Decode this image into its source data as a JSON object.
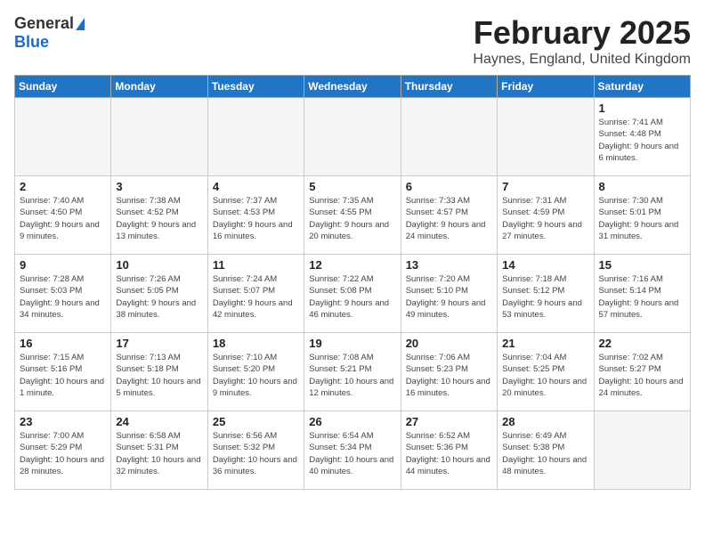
{
  "header": {
    "logo_general": "General",
    "logo_blue": "Blue",
    "title": "February 2025",
    "location": "Haynes, England, United Kingdom"
  },
  "calendar": {
    "headers": [
      "Sunday",
      "Monday",
      "Tuesday",
      "Wednesday",
      "Thursday",
      "Friday",
      "Saturday"
    ],
    "weeks": [
      [
        {
          "day": "",
          "info": "",
          "empty": true
        },
        {
          "day": "",
          "info": "",
          "empty": true
        },
        {
          "day": "",
          "info": "",
          "empty": true
        },
        {
          "day": "",
          "info": "",
          "empty": true
        },
        {
          "day": "",
          "info": "",
          "empty": true
        },
        {
          "day": "",
          "info": "",
          "empty": true
        },
        {
          "day": "1",
          "info": "Sunrise: 7:41 AM\nSunset: 4:48 PM\nDaylight: 9 hours and 6 minutes."
        }
      ],
      [
        {
          "day": "2",
          "info": "Sunrise: 7:40 AM\nSunset: 4:50 PM\nDaylight: 9 hours and 9 minutes."
        },
        {
          "day": "3",
          "info": "Sunrise: 7:38 AM\nSunset: 4:52 PM\nDaylight: 9 hours and 13 minutes."
        },
        {
          "day": "4",
          "info": "Sunrise: 7:37 AM\nSunset: 4:53 PM\nDaylight: 9 hours and 16 minutes."
        },
        {
          "day": "5",
          "info": "Sunrise: 7:35 AM\nSunset: 4:55 PM\nDaylight: 9 hours and 20 minutes."
        },
        {
          "day": "6",
          "info": "Sunrise: 7:33 AM\nSunset: 4:57 PM\nDaylight: 9 hours and 24 minutes."
        },
        {
          "day": "7",
          "info": "Sunrise: 7:31 AM\nSunset: 4:59 PM\nDaylight: 9 hours and 27 minutes."
        },
        {
          "day": "8",
          "info": "Sunrise: 7:30 AM\nSunset: 5:01 PM\nDaylight: 9 hours and 31 minutes."
        }
      ],
      [
        {
          "day": "9",
          "info": "Sunrise: 7:28 AM\nSunset: 5:03 PM\nDaylight: 9 hours and 34 minutes."
        },
        {
          "day": "10",
          "info": "Sunrise: 7:26 AM\nSunset: 5:05 PM\nDaylight: 9 hours and 38 minutes."
        },
        {
          "day": "11",
          "info": "Sunrise: 7:24 AM\nSunset: 5:07 PM\nDaylight: 9 hours and 42 minutes."
        },
        {
          "day": "12",
          "info": "Sunrise: 7:22 AM\nSunset: 5:08 PM\nDaylight: 9 hours and 46 minutes."
        },
        {
          "day": "13",
          "info": "Sunrise: 7:20 AM\nSunset: 5:10 PM\nDaylight: 9 hours and 49 minutes."
        },
        {
          "day": "14",
          "info": "Sunrise: 7:18 AM\nSunset: 5:12 PM\nDaylight: 9 hours and 53 minutes."
        },
        {
          "day": "15",
          "info": "Sunrise: 7:16 AM\nSunset: 5:14 PM\nDaylight: 9 hours and 57 minutes."
        }
      ],
      [
        {
          "day": "16",
          "info": "Sunrise: 7:15 AM\nSunset: 5:16 PM\nDaylight: 10 hours and 1 minute."
        },
        {
          "day": "17",
          "info": "Sunrise: 7:13 AM\nSunset: 5:18 PM\nDaylight: 10 hours and 5 minutes."
        },
        {
          "day": "18",
          "info": "Sunrise: 7:10 AM\nSunset: 5:20 PM\nDaylight: 10 hours and 9 minutes."
        },
        {
          "day": "19",
          "info": "Sunrise: 7:08 AM\nSunset: 5:21 PM\nDaylight: 10 hours and 12 minutes."
        },
        {
          "day": "20",
          "info": "Sunrise: 7:06 AM\nSunset: 5:23 PM\nDaylight: 10 hours and 16 minutes."
        },
        {
          "day": "21",
          "info": "Sunrise: 7:04 AM\nSunset: 5:25 PM\nDaylight: 10 hours and 20 minutes."
        },
        {
          "day": "22",
          "info": "Sunrise: 7:02 AM\nSunset: 5:27 PM\nDaylight: 10 hours and 24 minutes."
        }
      ],
      [
        {
          "day": "23",
          "info": "Sunrise: 7:00 AM\nSunset: 5:29 PM\nDaylight: 10 hours and 28 minutes."
        },
        {
          "day": "24",
          "info": "Sunrise: 6:58 AM\nSunset: 5:31 PM\nDaylight: 10 hours and 32 minutes."
        },
        {
          "day": "25",
          "info": "Sunrise: 6:56 AM\nSunset: 5:32 PM\nDaylight: 10 hours and 36 minutes."
        },
        {
          "day": "26",
          "info": "Sunrise: 6:54 AM\nSunset: 5:34 PM\nDaylight: 10 hours and 40 minutes."
        },
        {
          "day": "27",
          "info": "Sunrise: 6:52 AM\nSunset: 5:36 PM\nDaylight: 10 hours and 44 minutes."
        },
        {
          "day": "28",
          "info": "Sunrise: 6:49 AM\nSunset: 5:38 PM\nDaylight: 10 hours and 48 minutes."
        },
        {
          "day": "",
          "info": "",
          "empty": true
        }
      ]
    ]
  }
}
